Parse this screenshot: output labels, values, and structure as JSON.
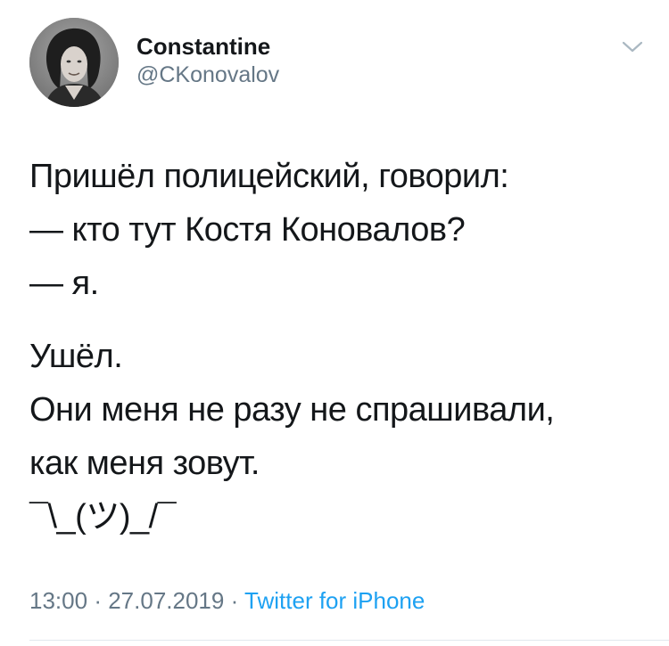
{
  "user": {
    "display_name": "Constantine",
    "handle": "@CKonovalov"
  },
  "icons": {
    "avatar": "profile-photo",
    "caret": "chevron-down-icon"
  },
  "tweet": {
    "lines": [
      "Пришёл полицейский, говорил:",
      "— кто тут Костя Коновалов?",
      "— я.",
      "Ушёл.",
      "Они меня не разу не спрашивали,",
      "как меня зовут.",
      "¯\\_(ツ)_/¯"
    ]
  },
  "meta": {
    "time": "13:00",
    "separator": "·",
    "date": "27.07.2019",
    "source": "Twitter for iPhone"
  },
  "colors": {
    "text": "#14171a",
    "secondary": "#657786",
    "link": "#1da1f2",
    "divider": "#e1e8ed"
  }
}
